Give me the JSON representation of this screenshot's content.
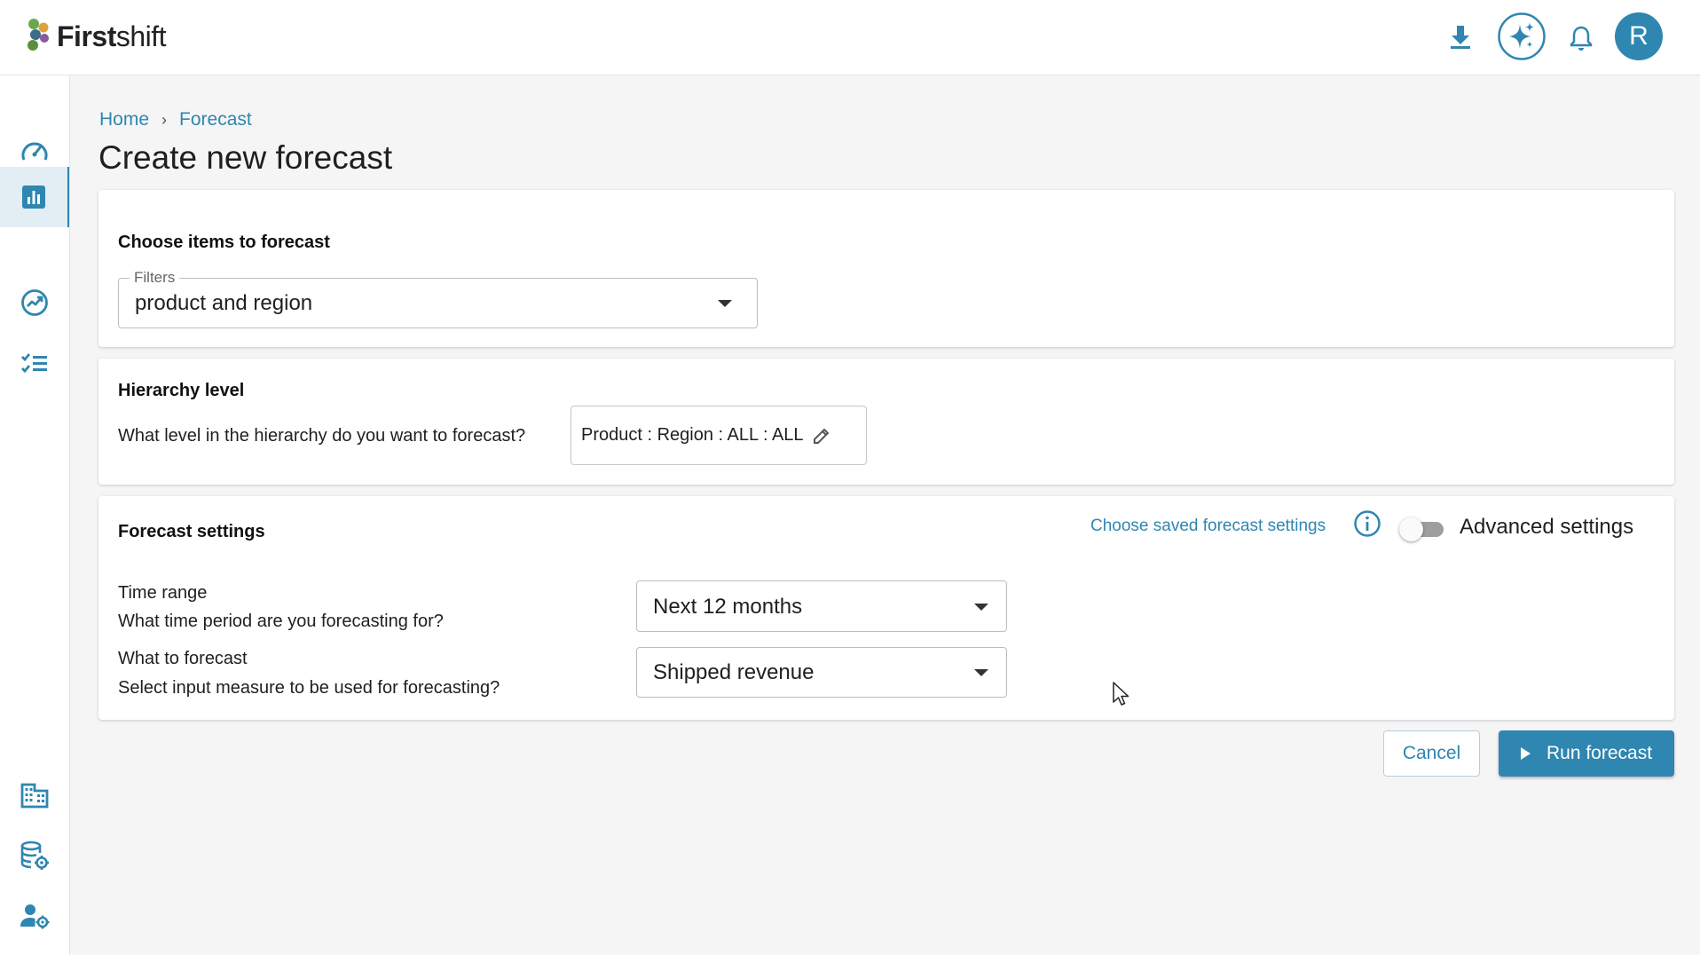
{
  "app": {
    "brand_bold": "First",
    "brand_light": "shift",
    "accent_color": "#2f86b0"
  },
  "topbar": {
    "icons": [
      "download-icon",
      "ai-sparkle-icon",
      "notification-bell-icon"
    ],
    "avatar_initial": "R"
  },
  "sidebar": {
    "items": [
      {
        "icon": "dashboard-gauge-icon",
        "active": false
      },
      {
        "icon": "bar-chart-icon",
        "active": true
      },
      {
        "icon": "trending-up-icon",
        "active": false
      },
      {
        "icon": "checklist-icon",
        "active": false
      },
      {
        "icon": "organization-building-icon",
        "active": false
      },
      {
        "icon": "database-settings-icon",
        "active": false
      },
      {
        "icon": "user-settings-icon",
        "active": false
      }
    ]
  },
  "breadcrumb": {
    "home": "Home",
    "separator": "›",
    "current": "Forecast"
  },
  "page": {
    "title": "Create new forecast"
  },
  "items_card": {
    "title": "Choose items to forecast",
    "filters_legend": "Filters",
    "filters_value": "product and region"
  },
  "hierarchy_card": {
    "title": "Hierarchy level",
    "question": "What level in the hierarchy do you want to forecast?",
    "value": "Product : Region : ALL : ALL"
  },
  "settings_card": {
    "title": "Forecast settings",
    "saved_settings_link": "Choose saved forecast settings",
    "advanced_label": "Advanced settings",
    "advanced_enabled": false,
    "time_range_label": "Time range",
    "time_range_question": "What time period are you forecasting for?",
    "time_range_value": "Next 12 months",
    "measure_label": "What to forecast",
    "measure_question": "Select input measure to be used for forecasting?",
    "measure_value": "Shipped revenue"
  },
  "actions": {
    "cancel_label": "Cancel",
    "run_label": "Run forecast"
  }
}
